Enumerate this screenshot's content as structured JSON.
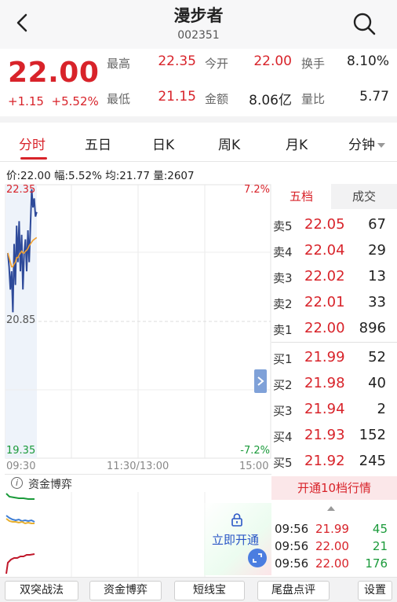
{
  "header": {
    "title": "漫步者",
    "code": "002351"
  },
  "quote": {
    "price": "22.00",
    "change": "+1.15",
    "change_pct": "+5.52%",
    "stats": [
      {
        "label": "最高",
        "value": "22.35"
      },
      {
        "label": "今开",
        "value": "22.00"
      },
      {
        "label": "换手",
        "value": "8.10%"
      },
      {
        "label": "最低",
        "value": "21.15"
      },
      {
        "label": "金额",
        "value": "8.06亿"
      },
      {
        "label": "量比",
        "value": "5.77"
      }
    ]
  },
  "tabs": [
    "分时",
    "五日",
    "日K",
    "周K",
    "月K",
    "分钟"
  ],
  "infoline": "价:22.00  幅:5.52%  均:21.77  量:2607",
  "chart_data": {
    "type": "line",
    "y_left_top": "22.35",
    "y_left_mid": "20.85",
    "y_left_bottom": "19.35",
    "y_right_top": "7.2%",
    "y_right_bottom": "-7.2%",
    "x_labels": [
      "09:30",
      "11:30/13:00",
      "15:00"
    ],
    "ylim": [
      19.35,
      22.35
    ],
    "series": [
      {
        "values": [
          21.6,
          21.45,
          21.2,
          21.4,
          20.95,
          21.7,
          21.25,
          21.9,
          21.5,
          21.95,
          21.4,
          21.8,
          21.2,
          21.6,
          21.75,
          21.4,
          21.85,
          21.5,
          21.9,
          22.3,
          22.1,
          22.2,
          22.0,
          22.05
        ]
      },
      {
        "values": [
          21.6,
          21.55,
          21.5,
          21.45,
          21.45,
          21.48,
          21.5,
          21.55,
          21.55,
          21.58,
          21.6,
          21.62,
          21.6,
          21.6,
          21.62,
          21.63,
          21.65,
          21.68,
          21.7,
          21.72,
          21.74,
          21.75,
          21.76,
          21.77
        ]
      }
    ]
  },
  "orderbook": {
    "tab_active": "五档",
    "tab_other": "成交",
    "asks": [
      {
        "label": "卖5",
        "price": "22.05",
        "vol": "67"
      },
      {
        "label": "卖4",
        "price": "22.04",
        "vol": "29"
      },
      {
        "label": "卖3",
        "price": "22.02",
        "vol": "13"
      },
      {
        "label": "卖2",
        "price": "22.01",
        "vol": "33"
      },
      {
        "label": "卖1",
        "price": "22.00",
        "vol": "896"
      }
    ],
    "bids": [
      {
        "label": "买1",
        "price": "21.99",
        "vol": "52"
      },
      {
        "label": "买2",
        "price": "21.98",
        "vol": "40"
      },
      {
        "label": "买3",
        "price": "21.94",
        "vol": "2"
      },
      {
        "label": "买4",
        "price": "21.93",
        "vol": "152"
      },
      {
        "label": "买5",
        "price": "21.92",
        "vol": "245"
      }
    ]
  },
  "fund": {
    "title": "资金博弈",
    "unlock": "立即开通"
  },
  "open10": "开通10档行情",
  "trades": [
    {
      "time": "09:56",
      "price": "21.99",
      "vol": "45",
      "color": "#1a9a3a"
    },
    {
      "time": "09:56",
      "price": "22.00",
      "vol": "21",
      "color": "#1a9a3a"
    },
    {
      "time": "09:56",
      "price": "22.00",
      "vol": "176",
      "color": "#1a9a3a"
    }
  ],
  "bottom_buttons": [
    "双突战法",
    "资金博弈",
    "短线宝",
    "尾盘点评",
    "设置"
  ],
  "colors": {
    "up": "#d8232a",
    "down": "#1a9a3a",
    "link": "#2a56c6"
  }
}
